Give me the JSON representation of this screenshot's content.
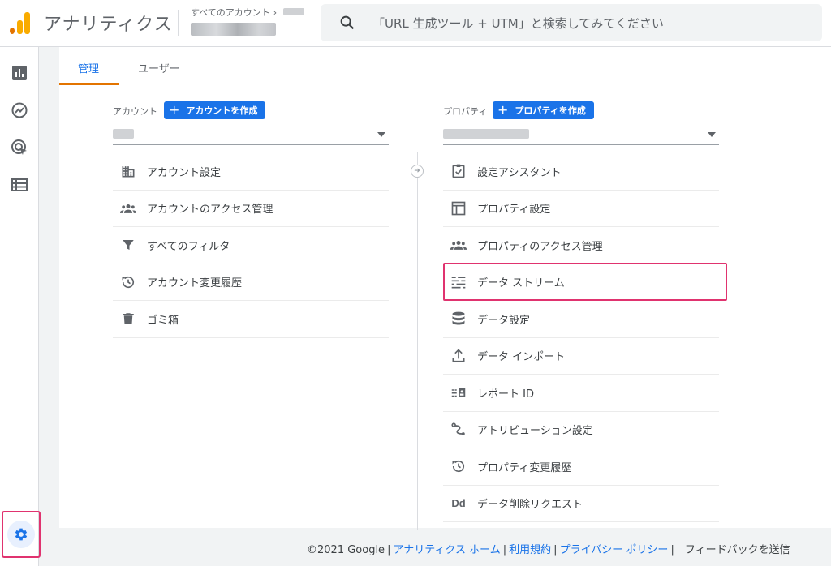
{
  "header": {
    "app_title": "アナリティクス",
    "account_crumb": "すべてのアカウント",
    "search_placeholder": "「URL 生成ツール + UTM」と検索してみてください"
  },
  "leftnav": {
    "icons": [
      "reports-icon",
      "explore-icon",
      "advertising-icon",
      "configure-icon"
    ],
    "admin_icon": "gear-icon"
  },
  "tabs": [
    {
      "label": "管理",
      "active": true
    },
    {
      "label": "ユーザー",
      "active": false
    }
  ],
  "account": {
    "label": "アカウント",
    "create_button": "アカウントを作成",
    "items": [
      {
        "label": "アカウント設定",
        "icon": "building-icon"
      },
      {
        "label": "アカウントのアクセス管理",
        "icon": "people-icon"
      },
      {
        "label": "すべてのフィルタ",
        "icon": "filter-icon"
      },
      {
        "label": "アカウント変更履歴",
        "icon": "history-icon"
      },
      {
        "label": "ゴミ箱",
        "icon": "trash-icon"
      }
    ]
  },
  "property": {
    "label": "プロパティ",
    "create_button": "プロパティを作成",
    "items": [
      {
        "label": "設定アシスタント",
        "icon": "clipboard-check-icon"
      },
      {
        "label": "プロパティ設定",
        "icon": "layout-icon"
      },
      {
        "label": "プロパティのアクセス管理",
        "icon": "people-icon"
      },
      {
        "label": "データ ストリーム",
        "icon": "data-stream-icon",
        "highlighted": true
      },
      {
        "label": "データ設定",
        "icon": "database-icon"
      },
      {
        "label": "データ インポート",
        "icon": "upload-icon"
      },
      {
        "label": "レポート ID",
        "icon": "report-id-icon"
      },
      {
        "label": "アトリビューション設定",
        "icon": "attribution-icon"
      },
      {
        "label": "プロパティ変更履歴",
        "icon": "history-icon"
      },
      {
        "label": "データ削除リクエスト",
        "icon": "dd-icon"
      }
    ]
  },
  "footer": {
    "copyright": "©2021 Google",
    "links": [
      "アナリティクス ホーム",
      "利用規約",
      "プライバシー ポリシー"
    ],
    "feedback": "フィードバックを送信"
  },
  "colors": {
    "accent_blue": "#1a73e8",
    "highlight_pink": "#e0336f",
    "tab_underline": "#e37400"
  }
}
